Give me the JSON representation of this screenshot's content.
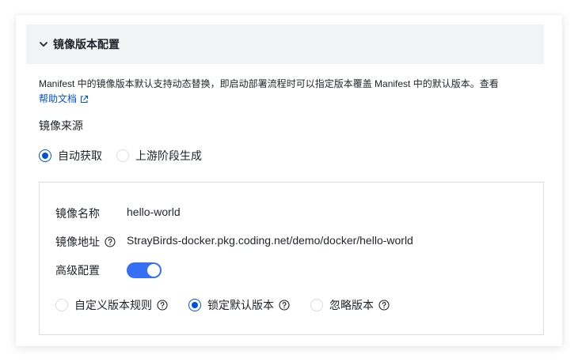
{
  "section": {
    "title": "镜像版本配置"
  },
  "description": {
    "text": "Manifest 中的镜像版本默认支持动态替换，即启动部署流程时可以指定版本覆盖 Manifest 中的默认版本。查看",
    "link_label": "帮助文档"
  },
  "image_source": {
    "label": "镜像来源",
    "options": [
      {
        "label": "自动获取",
        "checked": true
      },
      {
        "label": "上游阶段生成",
        "checked": false
      }
    ]
  },
  "details": {
    "name_label": "镜像名称",
    "name_value": "hello-world",
    "address_label": "镜像地址",
    "address_value": "StrayBirds-docker.pkg.coding.net/demo/docker/hello-world",
    "advanced_label": "高级配置",
    "advanced_enabled": true,
    "version_options": [
      {
        "label": "自定义版本规则",
        "checked": false
      },
      {
        "label": "锁定默认版本",
        "checked": true
      },
      {
        "label": "忽略版本",
        "checked": false
      }
    ]
  },
  "colors": {
    "accent": "#0052d9",
    "toggle_on": "#366ef4",
    "header_bg": "#f2f3f5",
    "border": "#dcdcdc"
  },
  "icons": [
    "chevron-down-icon",
    "external-link-icon",
    "help-circle-icon"
  ]
}
